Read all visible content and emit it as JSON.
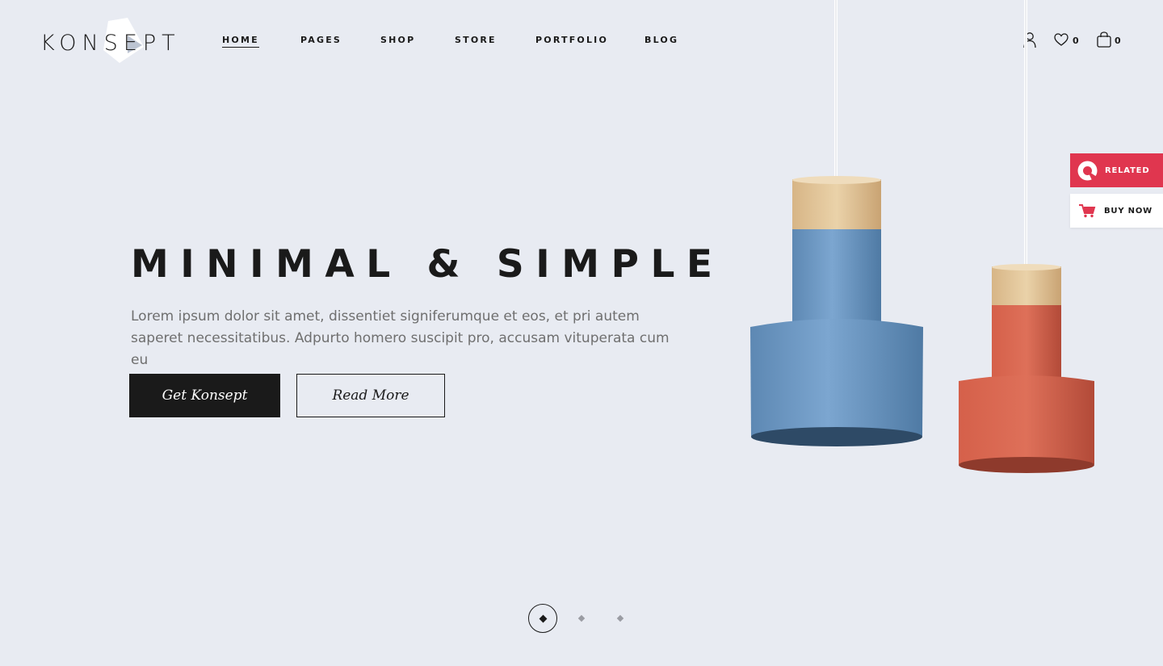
{
  "brand": {
    "name": "KONSEPT"
  },
  "nav": {
    "items": [
      {
        "label": "HOME",
        "active": true
      },
      {
        "label": "PAGES",
        "active": false
      },
      {
        "label": "SHOP",
        "active": false
      },
      {
        "label": "STORE",
        "active": false
      },
      {
        "label": "PORTFOLIO",
        "active": false
      },
      {
        "label": "BLOG",
        "active": false
      }
    ]
  },
  "header": {
    "user_icon": "user-icon",
    "wishlist": {
      "icon": "heart-icon",
      "count": "0"
    },
    "cart": {
      "icon": "shopping-bag-icon",
      "count": "0"
    }
  },
  "hero": {
    "title": "MINIMAL & SIMPLE",
    "description": "Lorem ipsum dolor sit amet, dissentiet signiferumque et eos, et pri autem saperet necessitatibus. Adpurto homero suscipit pro, accusam vituperata cum eu",
    "primary_button": "Get Konsept",
    "secondary_button": "Read More"
  },
  "side_panel": {
    "related_label": "RELATED",
    "buy_label": "BUY NOW"
  },
  "slider": {
    "active_index": 0,
    "total": 3
  },
  "colors": {
    "background": "#e8ebf2",
    "text": "#1a1a1a",
    "accent_red": "#e0364f",
    "lamp_blue": "#6d98c3",
    "lamp_orange": "#d05a45",
    "lamp_wood": "#d9b98b"
  }
}
